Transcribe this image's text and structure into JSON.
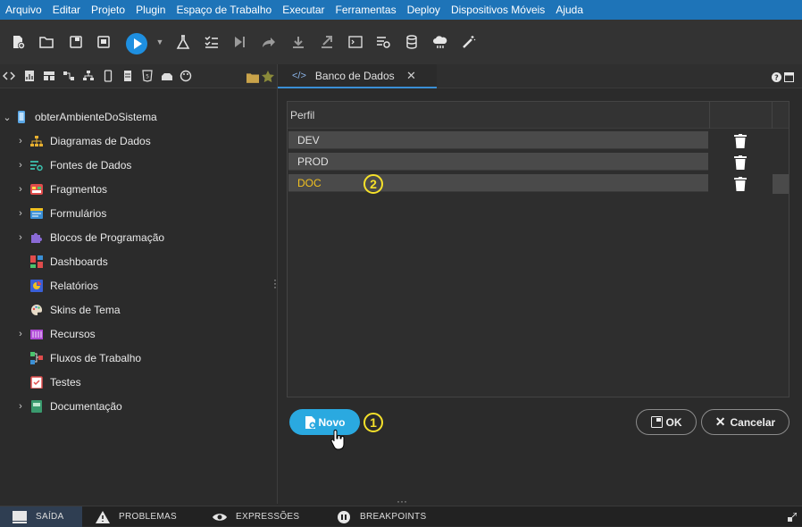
{
  "menu": [
    "Arquivo",
    "Editar",
    "Projeto",
    "Plugin",
    "Espaço de Trabalho",
    "Executar",
    "Ferramentas",
    "Deploy",
    "Dispositivos Móveis",
    "Ajuda"
  ],
  "tree": {
    "root": "obterAmbienteDoSistema",
    "items": [
      {
        "label": "Diagramas de Dados",
        "icon": "diagram-icon",
        "expandable": true
      },
      {
        "label": "Fontes de Dados",
        "icon": "datasource-icon",
        "expandable": true
      },
      {
        "label": "Fragmentos",
        "icon": "fragment-icon",
        "expandable": true
      },
      {
        "label": "Formulários",
        "icon": "form-icon",
        "expandable": true
      },
      {
        "label": "Blocos de Programação",
        "icon": "puzzle-icon",
        "expandable": true
      },
      {
        "label": "Dashboards",
        "icon": "dashboard-icon",
        "expandable": false
      },
      {
        "label": "Relatórios",
        "icon": "report-icon",
        "expandable": false
      },
      {
        "label": "Skins de Tema",
        "icon": "palette-icon",
        "expandable": false
      },
      {
        "label": "Recursos",
        "icon": "resources-icon",
        "expandable": true
      },
      {
        "label": "Fluxos de Trabalho",
        "icon": "workflow-icon",
        "expandable": false
      },
      {
        "label": "Testes",
        "icon": "test-icon",
        "expandable": false
      },
      {
        "label": "Documentação",
        "icon": "book-icon",
        "expandable": true
      }
    ]
  },
  "editor_tab": {
    "code": "</>",
    "title": "Banco de Dados"
  },
  "grid": {
    "header": "Perfil",
    "rows": [
      "DEV",
      "PROD",
      "DOC"
    ],
    "selected_row": "DOC"
  },
  "callouts": {
    "one": "1",
    "two": "2"
  },
  "buttons": {
    "novo": "Novo",
    "ok": "OK",
    "cancel": "Cancelar"
  },
  "bottom_tabs": [
    "SAÍDA",
    "PROBLEMAS",
    "EXPRESSÕES",
    "BREAKPOINTS"
  ],
  "colors": {
    "menubar": "#1e74b8",
    "accent": "#2aa9e0",
    "selected_text": "#f0c020",
    "callout": "#f5e12a"
  }
}
